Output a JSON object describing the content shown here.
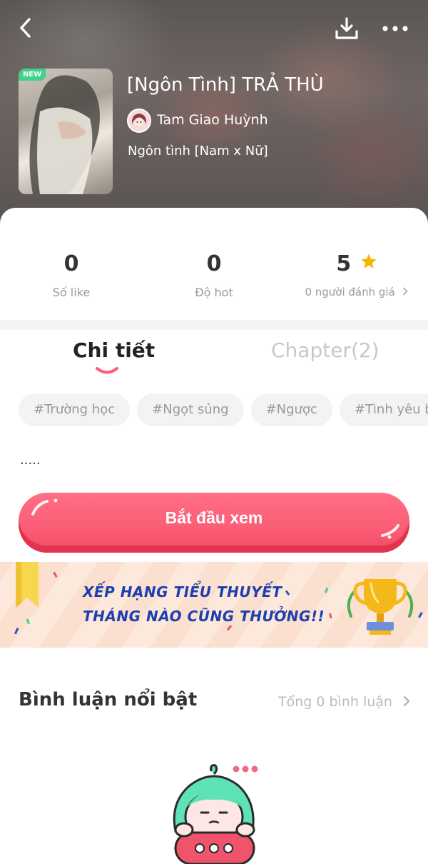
{
  "header": {
    "cover_badge": "NEW",
    "title": "[Ngôn Tình] TRẢ THÙ",
    "author": "Tam Giao Huỳnh",
    "genre": "Ngôn tình [Nam x Nữ]"
  },
  "stats": {
    "likes": {
      "value": "0",
      "label": "Số like"
    },
    "hot": {
      "value": "0",
      "label": "Độ hot"
    },
    "rating": {
      "value": "5",
      "label": "0 người đánh giá"
    }
  },
  "tabs": [
    {
      "label": "Chi tiết",
      "active": true
    },
    {
      "label": "Chapter(2)",
      "active": false
    }
  ],
  "tags": [
    "#Trường học",
    "#Ngọt sủng",
    "#Ngược",
    "#Tình yêu b"
  ],
  "description": ".....",
  "start_button": {
    "label": "Bắt đầu xem"
  },
  "banner": {
    "line1": "XẾP HẠNG TIỂU THUYẾT",
    "line2": "THÁNG NÀO CŨNG THƯỞNG!!"
  },
  "comments": {
    "title": "Bình luận nổi bật",
    "total": "Tổng 0 bình luận"
  },
  "colors": {
    "accent": "#fb5d76",
    "new_badge": "#3fd28a",
    "star": "#f8b500",
    "banner_text": "#1d3fb0"
  },
  "icons": [
    "back-arrow-icon",
    "download-icon",
    "more-icon",
    "star-icon",
    "chevron-right-icon",
    "trophy-icon"
  ]
}
